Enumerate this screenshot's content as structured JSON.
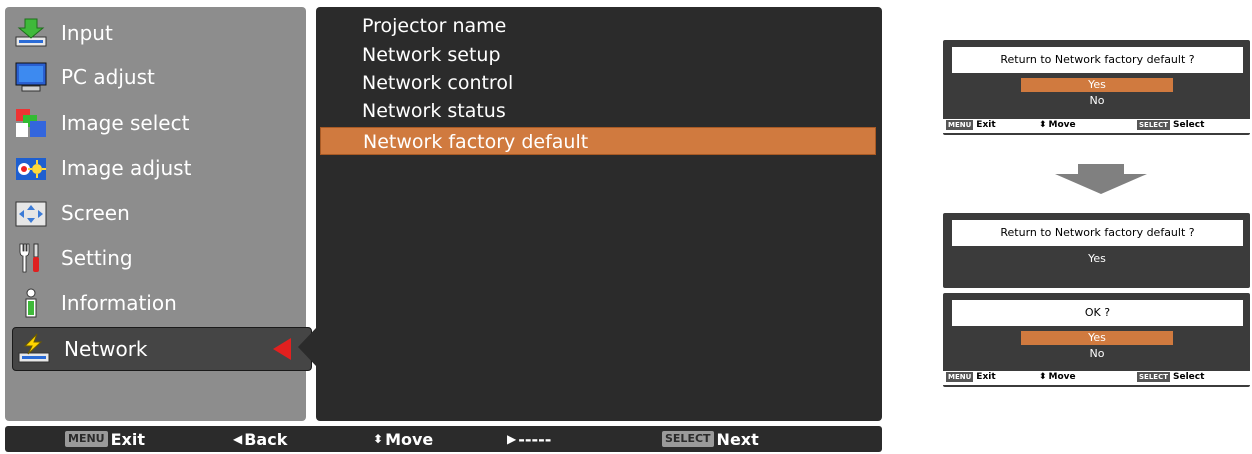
{
  "left_menu": {
    "items": [
      {
        "label": "Input",
        "icon": "input-icon"
      },
      {
        "label": "PC adjust",
        "icon": "pc-adjust-icon"
      },
      {
        "label": "Image select",
        "icon": "image-select-icon"
      },
      {
        "label": "Image adjust",
        "icon": "image-adjust-icon"
      },
      {
        "label": "Screen",
        "icon": "screen-icon"
      },
      {
        "label": "Setting",
        "icon": "setting-icon"
      },
      {
        "label": "Information",
        "icon": "information-icon"
      },
      {
        "label": "Network",
        "icon": "network-icon"
      }
    ],
    "selected": "Network"
  },
  "submenu": {
    "items": [
      "Projector name",
      "Network setup",
      "Network control",
      "Network status",
      "Network factory default"
    ],
    "selected": "Network factory default"
  },
  "bottom_bar": {
    "exit_key": "MENU",
    "exit_label": "Exit",
    "back_label": "Back",
    "move_label": "Move",
    "next_placeholder": "-----",
    "select_key": "SELECT",
    "next_label": "Next"
  },
  "dialog1": {
    "title": "Return to Network factory default ?",
    "options": [
      "Yes",
      "No"
    ],
    "selected": "Yes",
    "footer": {
      "exit_key": "MENU",
      "exit": "Exit",
      "move": "Move",
      "select_key": "SELECT",
      "select": "Select"
    }
  },
  "dialog2": {
    "title": "Return to Network factory default ?",
    "value": "Yes"
  },
  "dialog3": {
    "title": "OK ?",
    "options": [
      "Yes",
      "No"
    ],
    "selected": "Yes",
    "footer": {
      "exit_key": "MENU",
      "exit": "Exit",
      "move": "Move",
      "select_key": "SELECT",
      "select": "Select"
    }
  },
  "colors": {
    "highlight": "#d07a3f",
    "menu_panel": "#8d8d8d",
    "sub_panel": "#2b2b2b",
    "selection_arrow": "#e2201f"
  }
}
